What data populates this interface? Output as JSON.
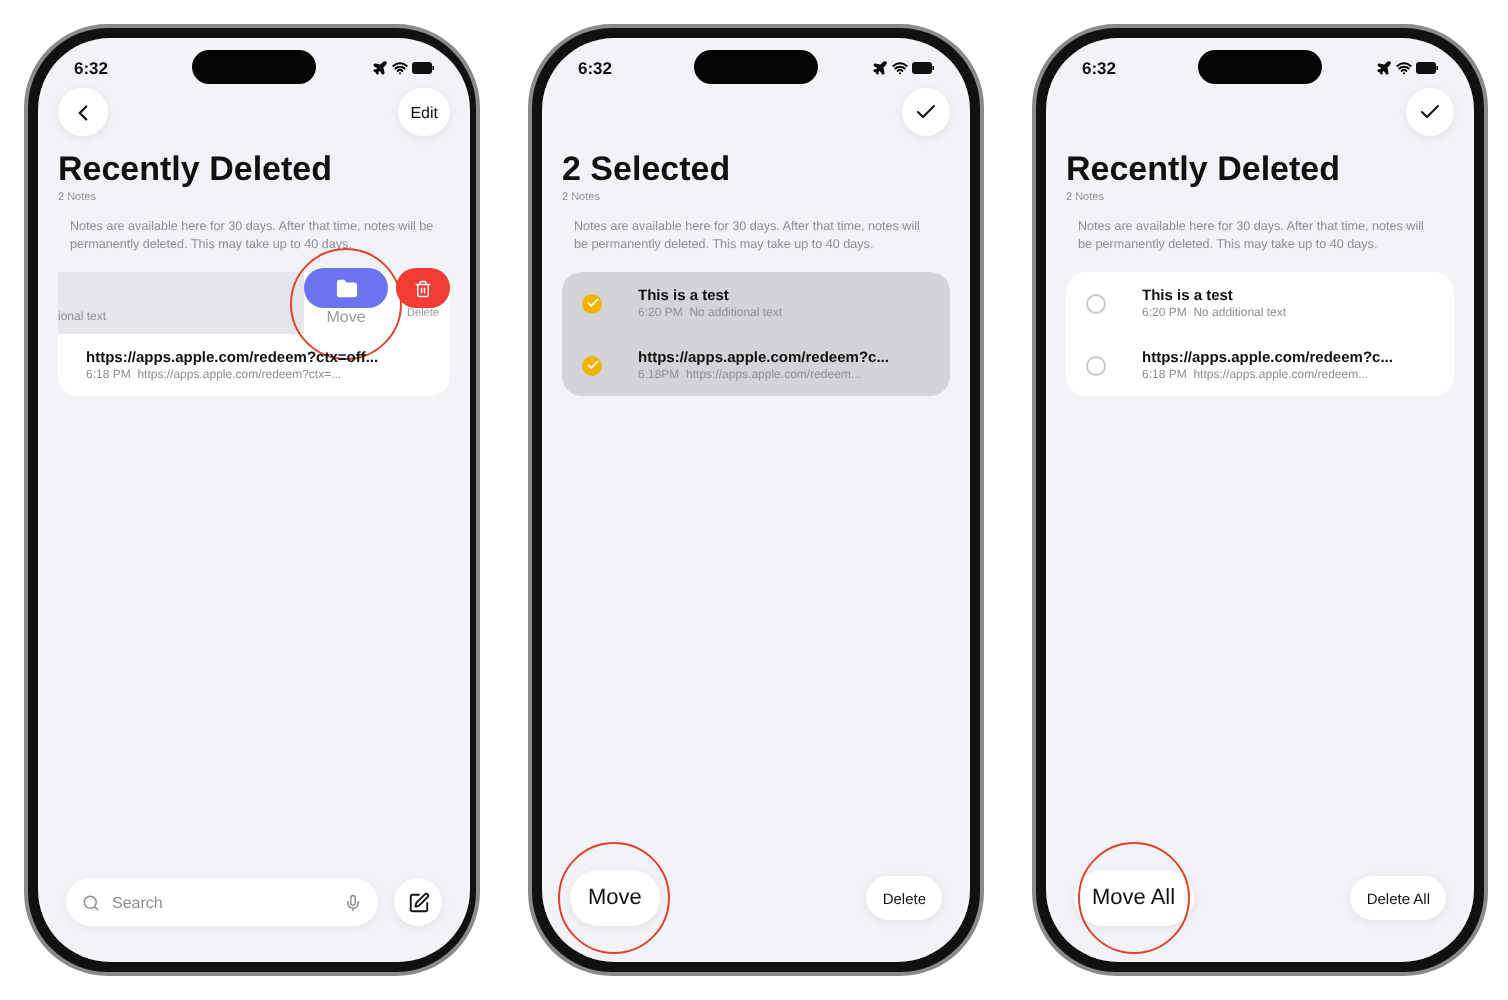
{
  "phones": [
    {
      "time": "6:32",
      "back_button": true,
      "top_action": {
        "kind": "text",
        "label": "Edit"
      },
      "title": "Recently Deleted",
      "subtitle": "2 Notes",
      "notice": "Notes are available here for 30 days. After that time, notes will be permanently deleted. This may take up to 40 days.",
      "notes": [
        {
          "kind": "swiped",
          "preview": "ional text",
          "actions": [
            {
              "kind": "move",
              "label": "Move",
              "highlighted": true
            },
            {
              "kind": "delete",
              "label": "Delete"
            }
          ]
        },
        {
          "kind": "plain",
          "title": "https://apps.apple.com/redeem?ctx=off...",
          "time": "6:18 PM",
          "preview": "https://apps.apple.com/redeem?ctx=..."
        }
      ],
      "bottom": {
        "kind": "search",
        "placeholder": "Search"
      }
    },
    {
      "time": "6:32",
      "top_action": {
        "kind": "check"
      },
      "title": "2 Selected",
      "subtitle": "2 Notes",
      "notice": "Notes are available here for 30 days. After that time, notes will be permanently deleted. This may take up to 40 days.",
      "notes": [
        {
          "kind": "selectable",
          "selected": true,
          "title": "This is a test",
          "time": "6:20 PM",
          "preview": "No additional text"
        },
        {
          "kind": "selectable",
          "selected": true,
          "title": "https://apps.apple.com/redeem?c...",
          "time": "6:18PM",
          "preview": "https://apps.apple.com/redeem..."
        }
      ],
      "bottom": {
        "kind": "actions",
        "left": {
          "label": "Move",
          "highlighted": true
        },
        "right": {
          "label": "Delete"
        }
      }
    },
    {
      "time": "6:32",
      "top_action": {
        "kind": "check"
      },
      "title": "Recently Deleted",
      "subtitle": "2 Notes",
      "notice": "Notes are available here for 30 days. After that time, notes will be permanently deleted. This may take up to 40 days.",
      "notes": [
        {
          "kind": "selectable",
          "selected": false,
          "title": "This is a test",
          "time": "6:20 PM",
          "preview": "No additional text"
        },
        {
          "kind": "selectable",
          "selected": false,
          "title": "https://apps.apple.com/redeem?c...",
          "time": "6:18 PM",
          "preview": "https://apps.apple.com/redeem..."
        }
      ],
      "bottom": {
        "kind": "actions",
        "left": {
          "label": "Move All",
          "highlighted": true
        },
        "right": {
          "label": "Delete All"
        }
      }
    }
  ]
}
